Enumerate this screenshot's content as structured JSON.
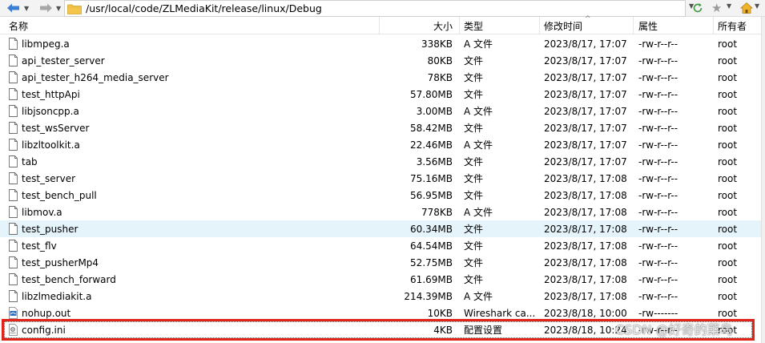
{
  "address_bar": {
    "path": "/usr/local/code/ZLMediaKit/release/linux/Debug"
  },
  "toolbar": {
    "back_icon": "back-arrow-icon",
    "forward_icon": "forward-arrow-icon",
    "folder_icon": "folder-icon",
    "refresh_icon": "refresh-icon",
    "bookmark_icon": "star-icon",
    "home_icon": "home-icon"
  },
  "columns": {
    "name": "名称",
    "size": "大小",
    "type": "类型",
    "modified": "修改时间",
    "permissions": "属性",
    "owner": "所有者",
    "sort_indicator": "^"
  },
  "files": [
    {
      "name": "libmpeg.a",
      "size": "338KB",
      "type": "A 文件",
      "modified": "2023/8/17, 17:07",
      "permissions": "-rw-r--r--",
      "owner": "root",
      "icon": "file-icon"
    },
    {
      "name": "api_tester_server",
      "size": "80KB",
      "type": "文件",
      "modified": "2023/8/17, 17:07",
      "permissions": "-rw-r--r--",
      "owner": "root",
      "icon": "file-icon"
    },
    {
      "name": "api_tester_h264_media_server",
      "size": "78KB",
      "type": "文件",
      "modified": "2023/8/17, 17:07",
      "permissions": "-rw-r--r--",
      "owner": "root",
      "icon": "file-icon"
    },
    {
      "name": "test_httpApi",
      "size": "57.80MB",
      "type": "文件",
      "modified": "2023/8/17, 17:07",
      "permissions": "-rw-r--r--",
      "owner": "root",
      "icon": "file-icon"
    },
    {
      "name": "libjsoncpp.a",
      "size": "3.00MB",
      "type": "A 文件",
      "modified": "2023/8/17, 17:07",
      "permissions": "-rw-r--r--",
      "owner": "root",
      "icon": "file-icon"
    },
    {
      "name": "test_wsServer",
      "size": "58.42MB",
      "type": "文件",
      "modified": "2023/8/17, 17:07",
      "permissions": "-rw-r--r--",
      "owner": "root",
      "icon": "file-icon"
    },
    {
      "name": "libzltoolkit.a",
      "size": "22.46MB",
      "type": "A 文件",
      "modified": "2023/8/17, 17:07",
      "permissions": "-rw-r--r--",
      "owner": "root",
      "icon": "file-icon"
    },
    {
      "name": "tab",
      "size": "3.56MB",
      "type": "文件",
      "modified": "2023/8/17, 17:07",
      "permissions": "-rw-r--r--",
      "owner": "root",
      "icon": "file-icon"
    },
    {
      "name": "test_server",
      "size": "75.16MB",
      "type": "文件",
      "modified": "2023/8/17, 17:08",
      "permissions": "-rw-r--r--",
      "owner": "root",
      "icon": "file-icon"
    },
    {
      "name": "test_bench_pull",
      "size": "56.95MB",
      "type": "文件",
      "modified": "2023/8/17, 17:08",
      "permissions": "-rw-r--r--",
      "owner": "root",
      "icon": "file-icon"
    },
    {
      "name": "libmov.a",
      "size": "778KB",
      "type": "A 文件",
      "modified": "2023/8/17, 17:08",
      "permissions": "-rw-r--r--",
      "owner": "root",
      "icon": "file-icon"
    },
    {
      "name": "test_pusher",
      "size": "60.34MB",
      "type": "文件",
      "modified": "2023/8/17, 17:08",
      "permissions": "-rw-r--r--",
      "owner": "root",
      "icon": "file-icon",
      "hovered": true
    },
    {
      "name": "test_flv",
      "size": "64.54MB",
      "type": "文件",
      "modified": "2023/8/17, 17:08",
      "permissions": "-rw-r--r--",
      "owner": "root",
      "icon": "file-icon"
    },
    {
      "name": "test_pusherMp4",
      "size": "52.75MB",
      "type": "文件",
      "modified": "2023/8/17, 17:08",
      "permissions": "-rw-r--r--",
      "owner": "root",
      "icon": "file-icon"
    },
    {
      "name": "test_bench_forward",
      "size": "61.69MB",
      "type": "文件",
      "modified": "2023/8/17, 17:08",
      "permissions": "-rw-r--r--",
      "owner": "root",
      "icon": "file-icon"
    },
    {
      "name": "libzlmediakit.a",
      "size": "214.39MB",
      "type": "A 文件",
      "modified": "2023/8/17, 17:08",
      "permissions": "-rw-r--r--",
      "owner": "root",
      "icon": "file-icon"
    },
    {
      "name": "nohup.out",
      "size": "10KB",
      "type": "Wireshark ca...",
      "modified": "2023/8/18, 10:00",
      "permissions": "-rw-------",
      "owner": "root",
      "icon": "wireshark-file-icon"
    },
    {
      "name": "config.ini",
      "size": "4KB",
      "type": "配置设置",
      "modified": "2023/8/18, 10:24",
      "permissions": "-rw-r--r--",
      "owner": "root",
      "icon": "ini-settings-file-icon",
      "selected": true
    }
  ],
  "watermark": "CSDN @好奇的菜鸟",
  "colors": {
    "highlight_border": "#e2231a",
    "hover_row": "#e5f3fb",
    "folder": "#f3c54b",
    "nav_arrow": "#3c7fd6"
  }
}
